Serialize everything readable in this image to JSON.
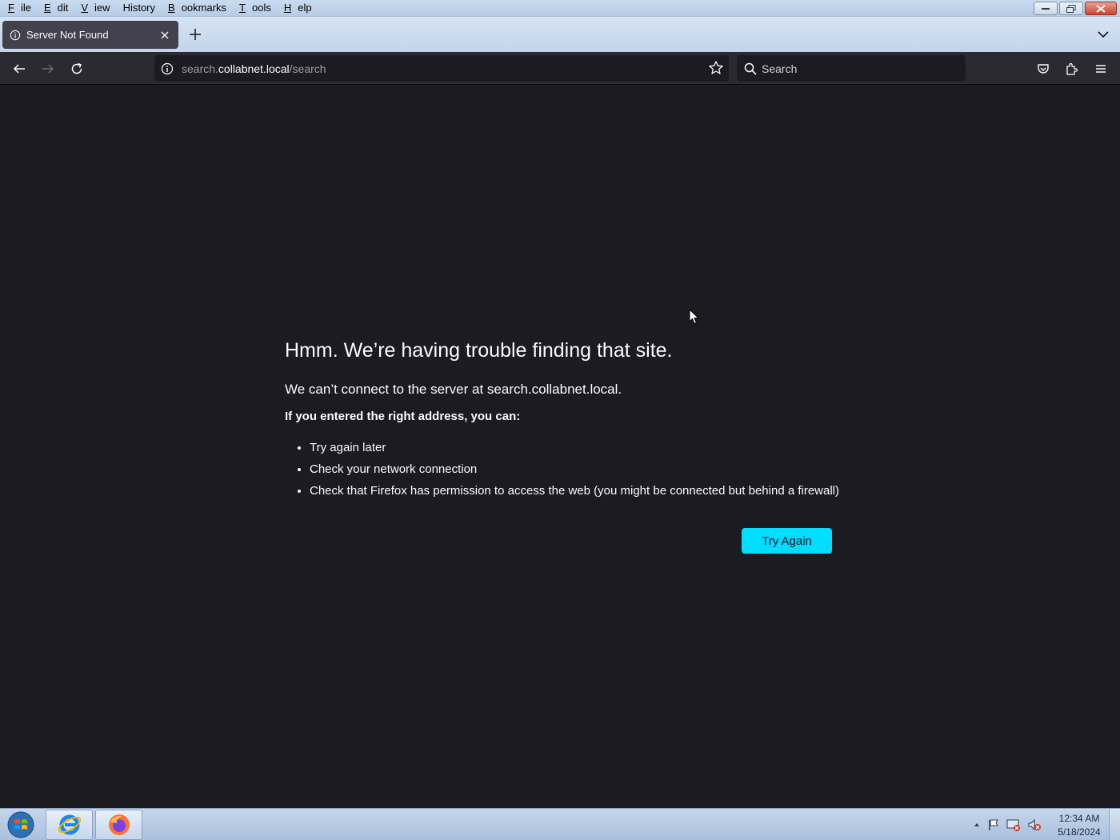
{
  "menubar": {
    "items": [
      {
        "label": "File",
        "key": "F",
        "rest": "ile"
      },
      {
        "label": "Edit",
        "key": "E",
        "rest": "dit"
      },
      {
        "label": "View",
        "key": "V",
        "rest": "iew"
      },
      {
        "label": "History",
        "key": "",
        "rest": "History"
      },
      {
        "label": "Bookmarks",
        "key": "B",
        "rest": "ookmarks"
      },
      {
        "label": "Tools",
        "key": "T",
        "rest": "ools"
      },
      {
        "label": "Help",
        "key": "H",
        "rest": "elp"
      }
    ]
  },
  "tab": {
    "title": "Server Not Found"
  },
  "navbar": {
    "url_prefix": "search.",
    "url_host": "collabnet.local",
    "url_path": "/search",
    "search_placeholder": "Search"
  },
  "error": {
    "title": "Hmm. We’re having trouble finding that site.",
    "description": "We can’t connect to the server at search.collabnet.local.",
    "advice_heading": "If you entered the right address, you can:",
    "suggestions": [
      "Try again later",
      "Check your network connection",
      "Check that Firefox has permission to access the web (you might be connected but behind a firewall)"
    ],
    "button_label": "Try Again"
  },
  "taskbar": {
    "clock_time": "12:34 AM",
    "clock_date": "5/18/2024"
  },
  "colors": {
    "content_bg": "#1c1b22",
    "accent_button": "#00ddff",
    "toolbar_bg": "#2b2a33"
  }
}
